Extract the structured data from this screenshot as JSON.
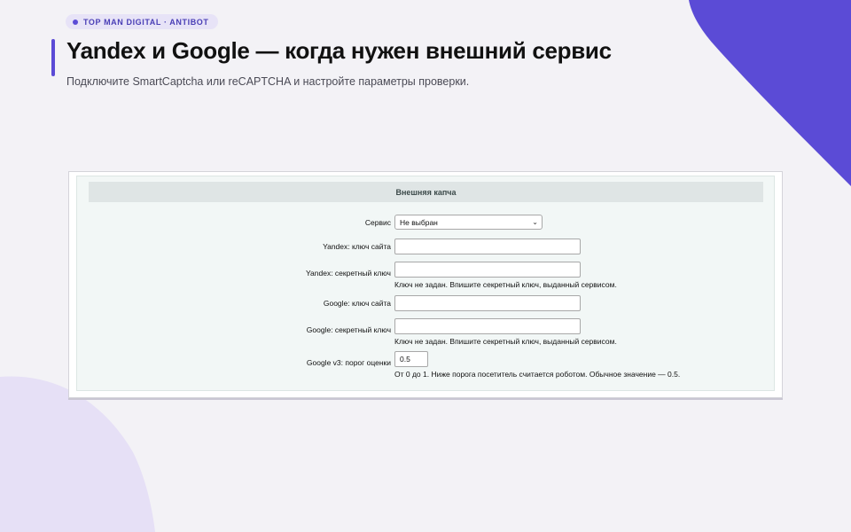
{
  "badge": {
    "text": "TOP MAN DIGITAL · ANTIBOT"
  },
  "page": {
    "title": "Yandex и Google — когда нужен внешний сервис",
    "subtitle": "Подключите SmartCaptcha или reCAPTCHA и настройте параметры проверки."
  },
  "panel": {
    "header": "Внешняя капча",
    "fields": {
      "service": {
        "label": "Сервис",
        "value": "Не выбран"
      },
      "yandex_site_key": {
        "label": "Yandex: ключ сайта",
        "value": ""
      },
      "yandex_secret_key": {
        "label": "Yandex: секретный ключ",
        "value": "",
        "hint": "Ключ не задан. Впишите секретный ключ, выданный сервисом."
      },
      "google_site_key": {
        "label": "Google: ключ сайта",
        "value": ""
      },
      "google_secret_key": {
        "label": "Google: секретный ключ",
        "value": "",
        "hint": "Ключ не задан. Впишите секретный ключ, выданный сервисом."
      },
      "google_v3_threshold": {
        "label": "Google v3: порог оценки",
        "value": "0.5",
        "hint": "От 0 до 1. Ниже порога посетитель считается роботом. Обычное значение — 0.5."
      }
    }
  },
  "colors": {
    "accent": "#5b4bd6",
    "background": "#f3f2f6",
    "panel_header": "#dfe5e5"
  }
}
